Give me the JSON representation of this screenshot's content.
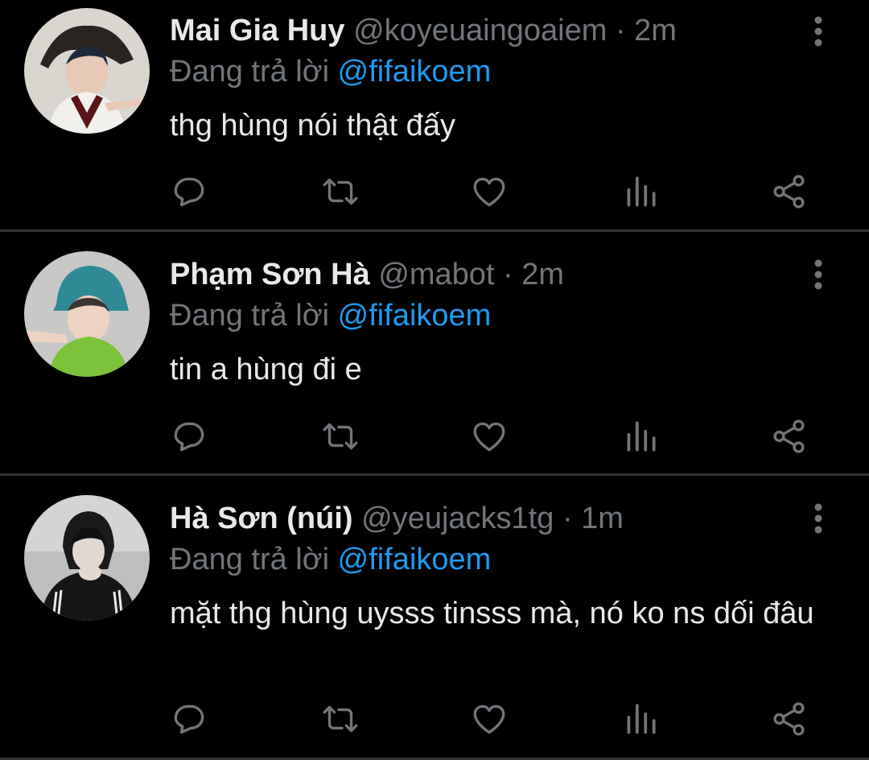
{
  "theme": {
    "background": "#000000",
    "text_primary": "#e7e9ea",
    "text_secondary": "#71767b",
    "accent": "#1d9bf0",
    "divider": "#2f3336",
    "icon": "#71767b"
  },
  "tweets": [
    {
      "display_name": "Mai Gia Huy",
      "handle": "@koyeuaingoaiem",
      "separator": "·",
      "time": "2m",
      "reply_prefix": "Đang trả lời ",
      "reply_to": "@fifaikoem",
      "text": "thg hùng nói thật đấy",
      "avatar_icon": "avatar-photo",
      "actions": [
        "reply-icon",
        "retweet-icon",
        "like-icon",
        "analytics-icon",
        "share-icon"
      ]
    },
    {
      "display_name": "Phạm Sơn Hà",
      "handle": "@mabot",
      "separator": "·",
      "time": "2m",
      "reply_prefix": "Đang trả lời ",
      "reply_to": "@fifaikoem",
      "text": "tin a hùng đi e",
      "avatar_icon": "avatar-photo",
      "actions": [
        "reply-icon",
        "retweet-icon",
        "like-icon",
        "analytics-icon",
        "share-icon"
      ]
    },
    {
      "display_name": "Hà Sơn (núi)",
      "handle": "@yeujacks1tg",
      "separator": "·",
      "time": "1m",
      "reply_prefix": "Đang trả lời ",
      "reply_to": "@fifaikoem",
      "text": "mặt thg hùng uysss tinsss mà, nó ko ns dối đâu",
      "avatar_icon": "avatar-photo",
      "actions": [
        "reply-icon",
        "retweet-icon",
        "like-icon",
        "analytics-icon",
        "share-icon"
      ]
    }
  ]
}
